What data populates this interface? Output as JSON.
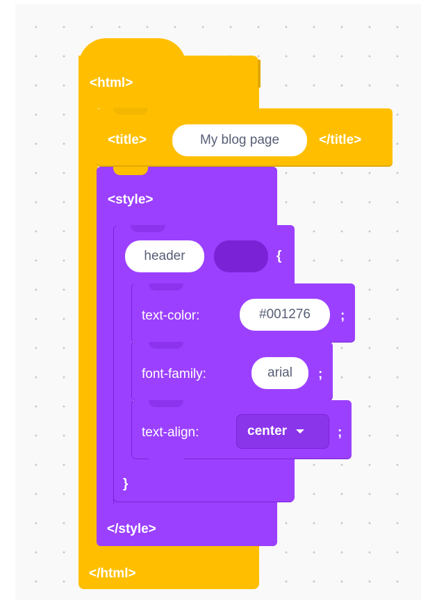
{
  "html_block": {
    "open_label": "<html>",
    "close_label": "</html>"
  },
  "title_block": {
    "open_label": "<title>",
    "value": "My blog page",
    "close_label": "</title>"
  },
  "style_block": {
    "open_label": "<style>",
    "close_label": "</style>"
  },
  "selector_block": {
    "selector_value": "header",
    "open_brace": "{",
    "close_brace": "}"
  },
  "properties": [
    {
      "name": "text-color:",
      "value": "#001276",
      "end": ";"
    },
    {
      "name": "font-family:",
      "value": "arial",
      "end": ";"
    },
    {
      "name": "text-align:",
      "value": "center",
      "end": ";"
    }
  ],
  "dropdown_icon": "caret-down-icon",
  "colors": {
    "html_block": "#ffbf00",
    "style_block": "#9b40ff",
    "selector_slot": "#7a23d6",
    "text_on_block": "#ffffff",
    "pill_text": "#575e75"
  }
}
